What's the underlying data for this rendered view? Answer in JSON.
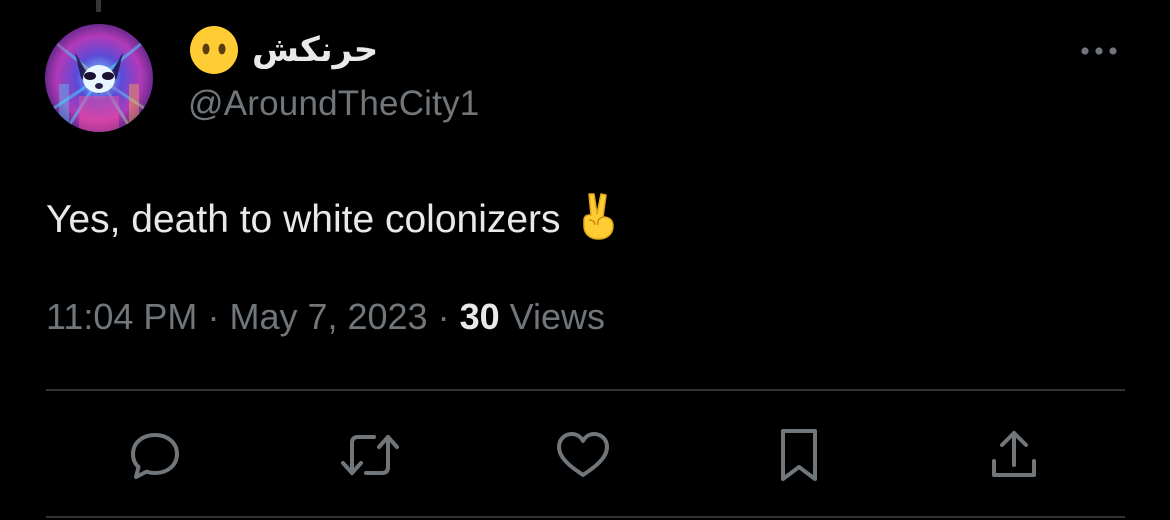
{
  "tweet": {
    "author": {
      "display_name": "حرنکش",
      "name_emoji": "dotted-face-emoji",
      "handle": "@AroundTheCity1",
      "avatar": "psychedelic-raccoon-avatar"
    },
    "text": "Yes, death to white colonizers",
    "text_emoji": "victory-hand-emoji",
    "meta": {
      "time": "11:04 PM",
      "separator": "·",
      "date": "May 7, 2023",
      "views_count": "30",
      "views_label": "Views"
    },
    "actions": [
      {
        "name": "reply",
        "icon": "reply-icon"
      },
      {
        "name": "retweet",
        "icon": "retweet-icon"
      },
      {
        "name": "like",
        "icon": "heart-icon"
      },
      {
        "name": "bookmark",
        "icon": "bookmark-icon"
      },
      {
        "name": "share",
        "icon": "share-icon"
      }
    ],
    "more_icon": "more-options-icon"
  },
  "colors": {
    "background": "#000000",
    "primary_text": "#e7e9ea",
    "secondary_text": "#71767b",
    "divider": "#2f3336",
    "emoji_yellow": "#ffcc33"
  }
}
